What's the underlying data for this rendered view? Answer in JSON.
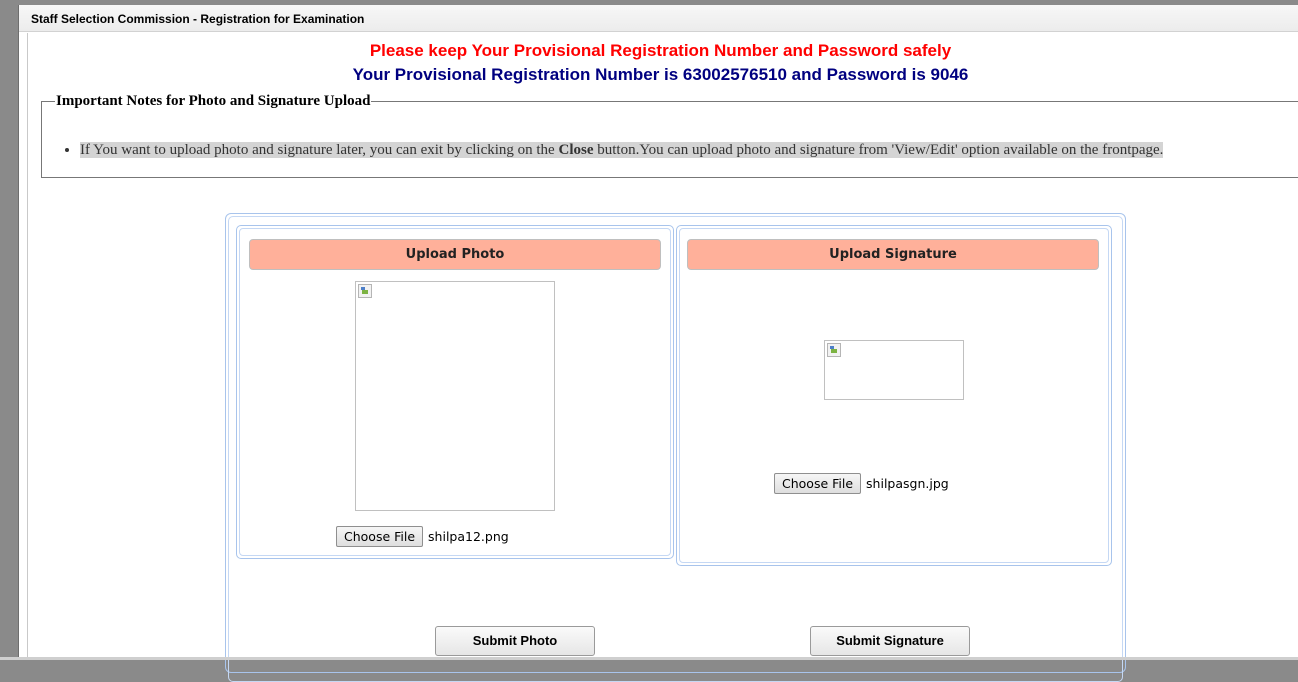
{
  "window": {
    "title": "Staff Selection Commission - Registration for Examination"
  },
  "header": {
    "warning": "Please keep Your Provisional Registration Number and Password safely",
    "credentials": "Your Provisional Registration Number is 63002576510 and Password is 9046"
  },
  "notes": {
    "legend": "Important Notes for Photo and Signature Upload",
    "item_prefix": "If You want to upload photo and signature later, you can exit by clicking on the ",
    "item_bold": "Close",
    "item_suffix": " button.You can upload photo and signature from 'View/Edit' option available on the frontpage."
  },
  "photo_panel": {
    "heading": "Upload Photo",
    "choose_label": "Choose File",
    "file_name": "shilpa12.png",
    "submit_label": "Submit Photo"
  },
  "signature_panel": {
    "heading": "Upload Signature",
    "choose_label": "Choose File",
    "file_name": "shilpasgn.jpg",
    "submit_label": "Submit Signature"
  },
  "colors": {
    "warning_text": "#ff0000",
    "credentials_text": "#000080",
    "panel_heading_bg": "#ffb09a",
    "panel_border": "#a8c4ec"
  }
}
